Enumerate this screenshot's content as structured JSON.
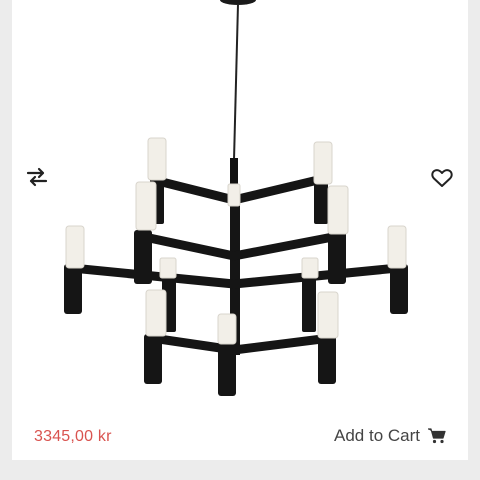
{
  "product": {
    "price": "3345,00 kr",
    "add_to_cart_label": "Add to Cart"
  },
  "icons": {
    "compare": "compare-arrows-icon",
    "wishlist": "heart-icon",
    "cart": "shopping-cart-icon"
  },
  "colors": {
    "price": "#d9534f",
    "action_text": "#444444"
  }
}
